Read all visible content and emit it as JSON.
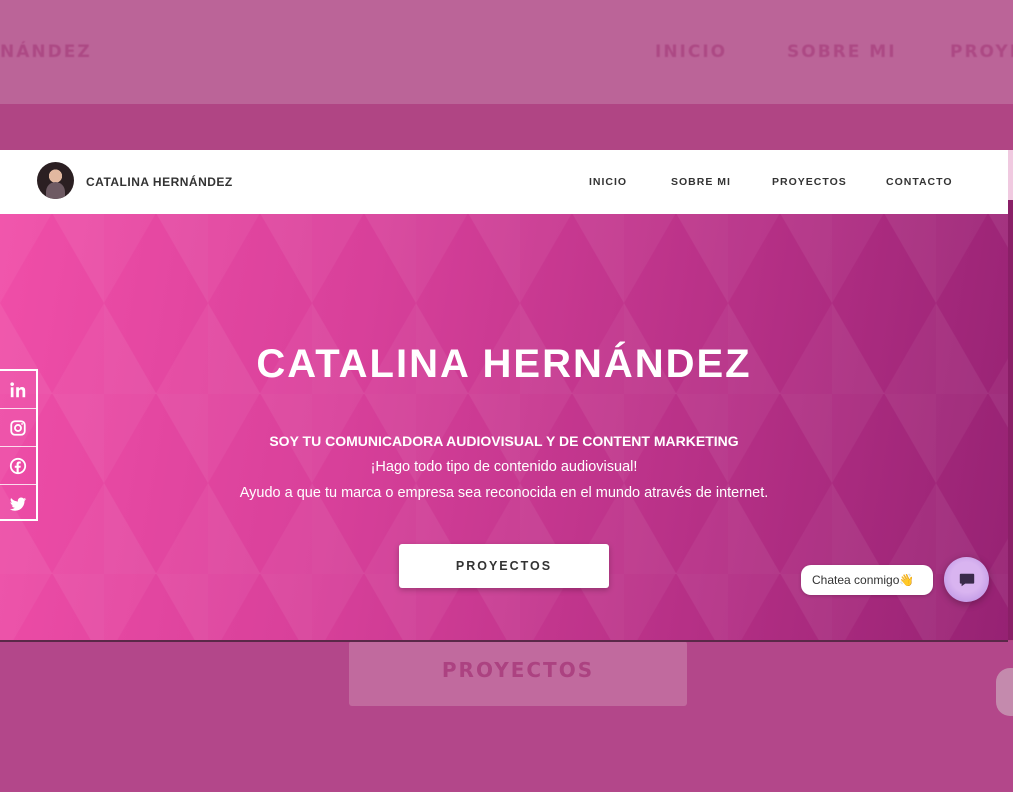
{
  "background_page": {
    "brand_partial": "NÁNDEZ",
    "nav": [
      "INICIO",
      "SOBRE MI",
      "PROYE"
    ],
    "button_label": "PROYECTOS"
  },
  "header": {
    "brand": "CATALINA HERNÁNDEZ",
    "nav": [
      "INICIO",
      "SOBRE MI",
      "PROYECTOS",
      "CONTACTO"
    ]
  },
  "hero": {
    "title": "CATALINA HERNÁNDEZ",
    "subtitle": "SOY TU COMUNICADORA AUDIOVISUAL Y DE CONTENT MARKETING",
    "line1": "¡Hago todo tipo de contenido audiovisual!",
    "line2": "Ayudo a que tu marca o empresa sea reconocida en el mundo através de internet.",
    "cta_label": "PROYECTOS"
  },
  "social": {
    "icons": [
      "linkedin-icon",
      "instagram-icon",
      "facebook-icon",
      "twitter-icon"
    ]
  },
  "chat": {
    "bubble_text": "Chatea conmigo👋"
  },
  "colors": {
    "hero_start": "#f04ea8",
    "hero_end": "#962273",
    "overlay_top": "#bb6498"
  }
}
